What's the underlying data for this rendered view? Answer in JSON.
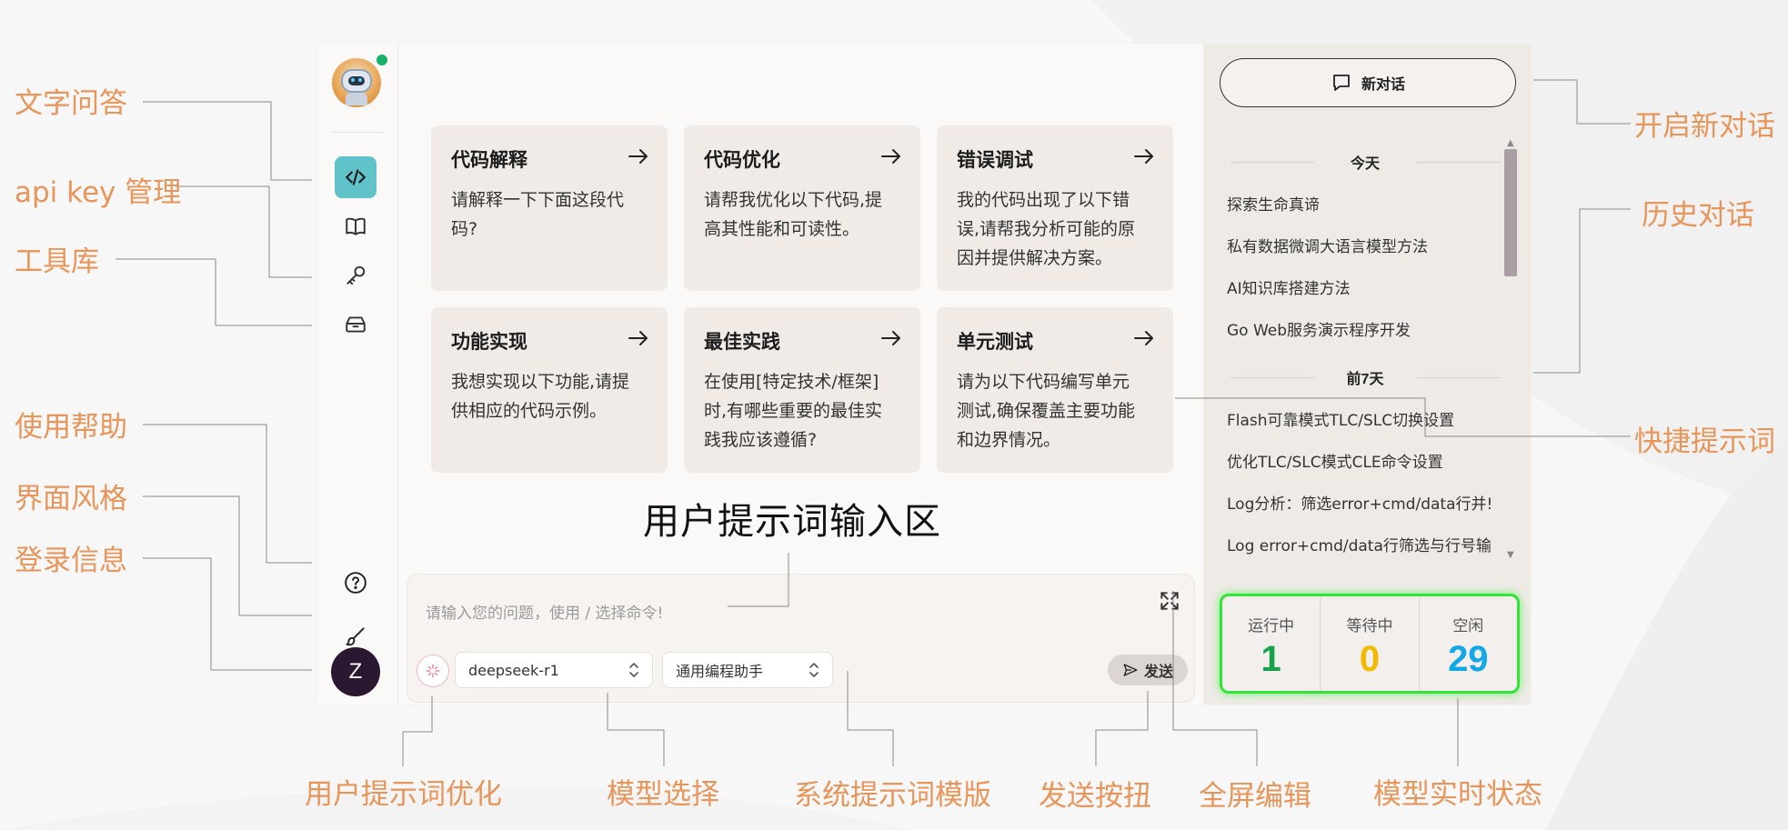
{
  "sidebar": {
    "nav": [
      {
        "name": "code-icon"
      },
      {
        "name": "book-icon"
      },
      {
        "name": "key-icon"
      },
      {
        "name": "toolbox-icon"
      }
    ],
    "bottom": [
      {
        "name": "help-icon"
      },
      {
        "name": "brush-icon"
      }
    ],
    "user_initial": "Z",
    "accent_color": "#5fc3c9"
  },
  "prompt_cards": [
    {
      "title": "代码解释",
      "desc_lines": [
        "请解释一下下面这段代",
        "码?"
      ]
    },
    {
      "title": "代码优化",
      "desc_lines": [
        "请帮我优化以下代码,提",
        "高其性能和可读性。"
      ]
    },
    {
      "title": "错误调试",
      "desc_lines": [
        "我的代码出现了以下错",
        "误,请帮我分析可能的原",
        "因并提供解决方案。"
      ]
    },
    {
      "title": "功能实现",
      "desc_lines": [
        "我想实现以下功能,请提",
        "供相应的代码示例。"
      ]
    },
    {
      "title": "最佳实践",
      "desc_lines": [
        "在使用[特定技术/框架]",
        "时,有哪些重要的最佳实",
        "践我应该遵循?"
      ]
    },
    {
      "title": "单元测试",
      "desc_lines": [
        "请为以下代码编写单元",
        "测试,确保覆盖主要功能",
        "和边界情况。"
      ]
    }
  ],
  "input": {
    "heading": "用户提示词输入区",
    "placeholder": "请输入您的问题，使用 / 选择命令!",
    "model": "deepseek-r1",
    "system_template": "通用编程助手",
    "send_label": "发送"
  },
  "history": {
    "new_chat_label": "新对话",
    "groups": [
      {
        "label": "今天",
        "items": [
          "探索生命真谛",
          "私有数据微调大语言模型方法",
          "AI知识库搭建方法",
          "Go Web服务演示程序开发"
        ]
      },
      {
        "label": "前7天",
        "items": [
          "Flash可靠模式TLC/SLC切换设置",
          "优化TLC/SLC模式CLE命令设置",
          "Log分析：筛选error+cmd/data行并!",
          "Log error+cmd/data行筛选与行号输"
        ]
      }
    ]
  },
  "status": [
    {
      "label": "运行中",
      "value": "1",
      "color": "#16a34a"
    },
    {
      "label": "等待中",
      "value": "0",
      "color": "#f5b800"
    },
    {
      "label": "空闲",
      "value": "29",
      "color": "#12a8e6"
    }
  ],
  "annotations": {
    "text_qa": "文字问答",
    "api_key": "api key 管理",
    "toolbox": "工具库",
    "help": "使用帮助",
    "theme": "界面风格",
    "login": "登录信息",
    "new_chat": "开启新对话",
    "history": "历史对话",
    "quick_prompt": "快捷提示词",
    "prompt_opt": "用户提示词优化",
    "model_select": "模型选择",
    "sys_template": "系统提示词模版",
    "send_btn": "发送按扭",
    "fullscreen": "全屏编辑",
    "model_status": "模型实时状态"
  }
}
